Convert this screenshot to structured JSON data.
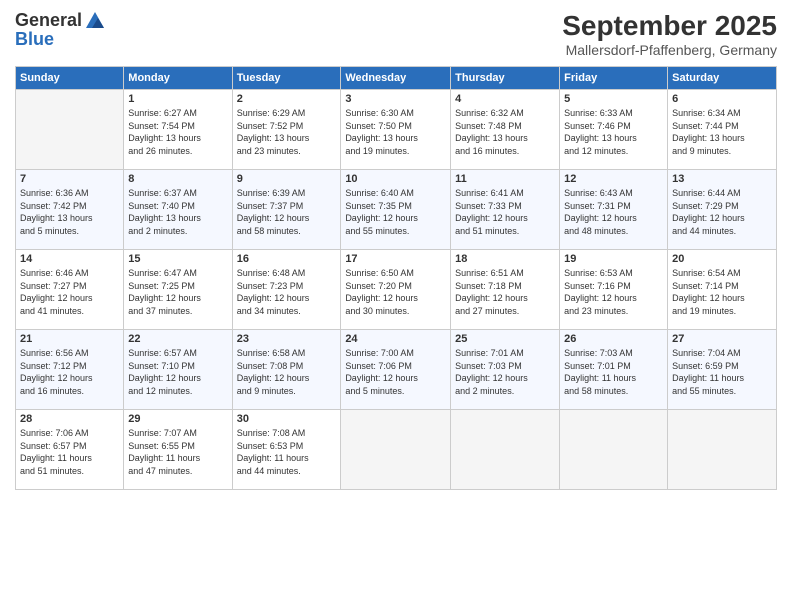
{
  "header": {
    "logo_general": "General",
    "logo_blue": "Blue",
    "month_title": "September 2025",
    "location": "Mallersdorf-Pfaffenberg, Germany"
  },
  "days_of_week": [
    "Sunday",
    "Monday",
    "Tuesday",
    "Wednesday",
    "Thursday",
    "Friday",
    "Saturday"
  ],
  "weeks": [
    [
      {
        "day": "",
        "info": ""
      },
      {
        "day": "1",
        "info": "Sunrise: 6:27 AM\nSunset: 7:54 PM\nDaylight: 13 hours\nand 26 minutes."
      },
      {
        "day": "2",
        "info": "Sunrise: 6:29 AM\nSunset: 7:52 PM\nDaylight: 13 hours\nand 23 minutes."
      },
      {
        "day": "3",
        "info": "Sunrise: 6:30 AM\nSunset: 7:50 PM\nDaylight: 13 hours\nand 19 minutes."
      },
      {
        "day": "4",
        "info": "Sunrise: 6:32 AM\nSunset: 7:48 PM\nDaylight: 13 hours\nand 16 minutes."
      },
      {
        "day": "5",
        "info": "Sunrise: 6:33 AM\nSunset: 7:46 PM\nDaylight: 13 hours\nand 12 minutes."
      },
      {
        "day": "6",
        "info": "Sunrise: 6:34 AM\nSunset: 7:44 PM\nDaylight: 13 hours\nand 9 minutes."
      }
    ],
    [
      {
        "day": "7",
        "info": "Sunrise: 6:36 AM\nSunset: 7:42 PM\nDaylight: 13 hours\nand 5 minutes."
      },
      {
        "day": "8",
        "info": "Sunrise: 6:37 AM\nSunset: 7:40 PM\nDaylight: 13 hours\nand 2 minutes."
      },
      {
        "day": "9",
        "info": "Sunrise: 6:39 AM\nSunset: 7:37 PM\nDaylight: 12 hours\nand 58 minutes."
      },
      {
        "day": "10",
        "info": "Sunrise: 6:40 AM\nSunset: 7:35 PM\nDaylight: 12 hours\nand 55 minutes."
      },
      {
        "day": "11",
        "info": "Sunrise: 6:41 AM\nSunset: 7:33 PM\nDaylight: 12 hours\nand 51 minutes."
      },
      {
        "day": "12",
        "info": "Sunrise: 6:43 AM\nSunset: 7:31 PM\nDaylight: 12 hours\nand 48 minutes."
      },
      {
        "day": "13",
        "info": "Sunrise: 6:44 AM\nSunset: 7:29 PM\nDaylight: 12 hours\nand 44 minutes."
      }
    ],
    [
      {
        "day": "14",
        "info": "Sunrise: 6:46 AM\nSunset: 7:27 PM\nDaylight: 12 hours\nand 41 minutes."
      },
      {
        "day": "15",
        "info": "Sunrise: 6:47 AM\nSunset: 7:25 PM\nDaylight: 12 hours\nand 37 minutes."
      },
      {
        "day": "16",
        "info": "Sunrise: 6:48 AM\nSunset: 7:23 PM\nDaylight: 12 hours\nand 34 minutes."
      },
      {
        "day": "17",
        "info": "Sunrise: 6:50 AM\nSunset: 7:20 PM\nDaylight: 12 hours\nand 30 minutes."
      },
      {
        "day": "18",
        "info": "Sunrise: 6:51 AM\nSunset: 7:18 PM\nDaylight: 12 hours\nand 27 minutes."
      },
      {
        "day": "19",
        "info": "Sunrise: 6:53 AM\nSunset: 7:16 PM\nDaylight: 12 hours\nand 23 minutes."
      },
      {
        "day": "20",
        "info": "Sunrise: 6:54 AM\nSunset: 7:14 PM\nDaylight: 12 hours\nand 19 minutes."
      }
    ],
    [
      {
        "day": "21",
        "info": "Sunrise: 6:56 AM\nSunset: 7:12 PM\nDaylight: 12 hours\nand 16 minutes."
      },
      {
        "day": "22",
        "info": "Sunrise: 6:57 AM\nSunset: 7:10 PM\nDaylight: 12 hours\nand 12 minutes."
      },
      {
        "day": "23",
        "info": "Sunrise: 6:58 AM\nSunset: 7:08 PM\nDaylight: 12 hours\nand 9 minutes."
      },
      {
        "day": "24",
        "info": "Sunrise: 7:00 AM\nSunset: 7:06 PM\nDaylight: 12 hours\nand 5 minutes."
      },
      {
        "day": "25",
        "info": "Sunrise: 7:01 AM\nSunset: 7:03 PM\nDaylight: 12 hours\nand 2 minutes."
      },
      {
        "day": "26",
        "info": "Sunrise: 7:03 AM\nSunset: 7:01 PM\nDaylight: 11 hours\nand 58 minutes."
      },
      {
        "day": "27",
        "info": "Sunrise: 7:04 AM\nSunset: 6:59 PM\nDaylight: 11 hours\nand 55 minutes."
      }
    ],
    [
      {
        "day": "28",
        "info": "Sunrise: 7:06 AM\nSunset: 6:57 PM\nDaylight: 11 hours\nand 51 minutes."
      },
      {
        "day": "29",
        "info": "Sunrise: 7:07 AM\nSunset: 6:55 PM\nDaylight: 11 hours\nand 47 minutes."
      },
      {
        "day": "30",
        "info": "Sunrise: 7:08 AM\nSunset: 6:53 PM\nDaylight: 11 hours\nand 44 minutes."
      },
      {
        "day": "",
        "info": ""
      },
      {
        "day": "",
        "info": ""
      },
      {
        "day": "",
        "info": ""
      },
      {
        "day": "",
        "info": ""
      }
    ]
  ]
}
